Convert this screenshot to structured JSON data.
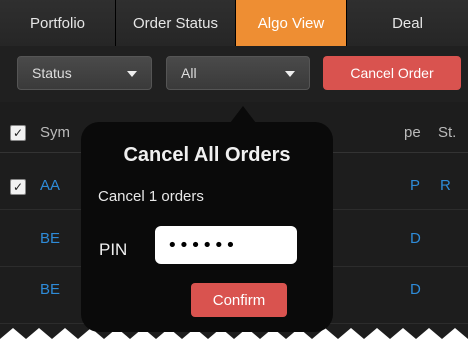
{
  "tabs": [
    {
      "label": "Portfolio",
      "active": false
    },
    {
      "label": "Order Status",
      "active": false
    },
    {
      "label": "Algo View",
      "active": true
    },
    {
      "label": "Deal",
      "active": false
    }
  ],
  "toolbar": {
    "status_select": "Status",
    "filter_select": "All",
    "cancel_order_label": "Cancel Order"
  },
  "table": {
    "headers": {
      "symbol": "Sym",
      "type": "pe",
      "status": "St."
    },
    "rows": [
      {
        "symbol": "AA",
        "type": "P",
        "status": "R",
        "checked": true
      },
      {
        "symbol": "BE",
        "type": "D",
        "status": "",
        "checked": false
      },
      {
        "symbol": "BE",
        "type": "D",
        "status": "",
        "checked": false
      }
    ]
  },
  "modal": {
    "title": "Cancel All Orders",
    "message": "Cancel 1 orders",
    "pin_label": "PIN",
    "pin_value": "••••••",
    "confirm_label": "Confirm"
  },
  "colors": {
    "accent_tab": "#ee8e33",
    "danger_button": "#d9534f",
    "link_blue": "#2e8bd8"
  }
}
